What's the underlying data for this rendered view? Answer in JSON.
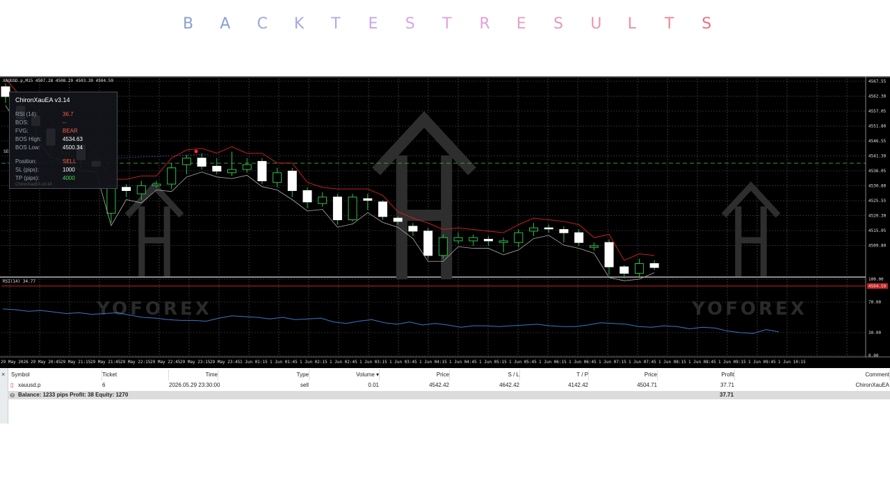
{
  "title_letters": [
    "B",
    "A",
    "C",
    "K",
    "T",
    "E",
    "S",
    "T",
    "R",
    "E",
    "S",
    "U",
    "L",
    "T",
    "S"
  ],
  "title_colors": [
    "#8a9fd8",
    "#8a9fd8",
    "#9ca6e0",
    "#a6a8e4",
    "#b9a8e6",
    "#c8a6e8",
    "#d6a6e6",
    "#dea4e0",
    "#e3a0d4",
    "#e6a0c8",
    "#ea98bc",
    "#ec96b0",
    "#ee8ea6",
    "#ee8698",
    "#ee6e86"
  ],
  "chart": {
    "symbol_line": "XAUUSD.p,M15  4507.28 4508.29 4503.39 4504.59",
    "rsi_label": "RSI(14) 34.77",
    "price_ticks": [
      "4567.55",
      "4562.30",
      "4557.05",
      "4551.80",
      "4546.55",
      "4541.30",
      "4536.05",
      "4530.80",
      "4525.55",
      "4520.30",
      "4515.05",
      "4509.80"
    ],
    "current_price": "4504.59",
    "rsi_ticks": [
      "100.00",
      "70.00",
      "30.00",
      "0.00"
    ],
    "time_ticks": [
      "29 May 2026",
      "29 May 20:45",
      "29 May 21:15",
      "29 May 21:45",
      "29 May 22:15",
      "29 May 22:45",
      "29 May 23:15",
      "29 May 23:45",
      "1 Jun 01:15",
      "1 Jun 01:45",
      "1 Jun 02:15",
      "1 Jun 02:45",
      "1 Jun 03:15",
      "1 Jun 03:45",
      "1 Jun 04:15",
      "1 Jun 04:45",
      "1 Jun 05:15",
      "1 Jun 05:45",
      "1 Jun 06:15",
      "1 Jun 06:45",
      "1 Jun 07:15",
      "1 Jun 07:45",
      "1 Jun 08:15",
      "1 Jun 08:45",
      "1 Jun 09:15",
      "1 Jun 09:45",
      "1 Jun 10:15"
    ],
    "watermark_text": "YOFOREX",
    "sell_marker": "SEL"
  },
  "chart_data": {
    "type": "candlestick",
    "symbol": "XAUUSD.p",
    "timeframe": "M15",
    "ylim": [
      4507.55,
      4568.55
    ],
    "bid_line": 4504.59,
    "entry_line": 4542.42,
    "candles": [
      {
        "o": 4566.0,
        "c": 4563.0,
        "h": 4567.0,
        "l": 4561.0
      },
      {
        "o": 4560.0,
        "c": 4556.0,
        "h": 4561.5,
        "l": 4554.0
      },
      {
        "o": 4557.0,
        "c": 4554.0,
        "h": 4558.0,
        "l": 4551.0
      },
      {
        "o": 4553.0,
        "c": 4548.0,
        "h": 4554.0,
        "l": 4545.0
      },
      {
        "o": 4545.5,
        "c": 4548.5,
        "h": 4549.5,
        "l": 4544.0
      },
      {
        "o": 4548.0,
        "c": 4543.5,
        "h": 4549.0,
        "l": 4541.0
      },
      {
        "o": 4543.0,
        "c": 4541.5,
        "h": 4544.0,
        "l": 4540.5
      },
      {
        "o": 4527.0,
        "c": 4535.5,
        "h": 4536.0,
        "l": 4524.0
      },
      {
        "o": 4535.0,
        "c": 4534.0,
        "h": 4536.0,
        "l": 4532.0
      },
      {
        "o": 4533.0,
        "c": 4535.5,
        "h": 4537.0,
        "l": 4531.0
      },
      {
        "o": 4535.5,
        "c": 4536.0,
        "h": 4537.0,
        "l": 4535.0
      },
      {
        "o": 4536.0,
        "c": 4541.0,
        "h": 4542.5,
        "l": 4534.5
      },
      {
        "o": 4542.0,
        "c": 4544.0,
        "h": 4545.0,
        "l": 4539.0
      },
      {
        "o": 4544.0,
        "c": 4541.5,
        "h": 4545.5,
        "l": 4540.5
      },
      {
        "o": 4541.5,
        "c": 4540.0,
        "h": 4544.0,
        "l": 4539.0
      },
      {
        "o": 4539.5,
        "c": 4540.5,
        "h": 4546.0,
        "l": 4538.5
      },
      {
        "o": 4540.5,
        "c": 4542.0,
        "h": 4544.0,
        "l": 4539.5
      },
      {
        "o": 4543.0,
        "c": 4537.0,
        "h": 4544.0,
        "l": 4536.0
      },
      {
        "o": 4536.5,
        "c": 4539.5,
        "h": 4541.0,
        "l": 4535.0
      },
      {
        "o": 4540.0,
        "c": 4534.0,
        "h": 4541.0,
        "l": 4532.0
      },
      {
        "o": 4534.0,
        "c": 4530.5,
        "h": 4535.0,
        "l": 4528.5
      },
      {
        "o": 4530.0,
        "c": 4532.0,
        "h": 4533.5,
        "l": 4529.0
      },
      {
        "o": 4532.0,
        "c": 4525.0,
        "h": 4533.0,
        "l": 4523.5
      },
      {
        "o": 4525.0,
        "c": 4532.0,
        "h": 4533.0,
        "l": 4524.5
      },
      {
        "o": 4531.5,
        "c": 4531.0,
        "h": 4533.0,
        "l": 4528.0
      },
      {
        "o": 4530.5,
        "c": 4526.0,
        "h": 4531.0,
        "l": 4525.0
      },
      {
        "o": 4525.5,
        "c": 4524.5,
        "h": 4526.0,
        "l": 4523.5
      },
      {
        "o": 4523.0,
        "c": 4521.5,
        "h": 4524.0,
        "l": 4520.0
      },
      {
        "o": 4521.5,
        "c": 4514.0,
        "h": 4522.5,
        "l": 4513.0
      },
      {
        "o": 4514.0,
        "c": 4519.5,
        "h": 4520.5,
        "l": 4513.0
      },
      {
        "o": 4518.5,
        "c": 4519.5,
        "h": 4521.0,
        "l": 4517.5
      },
      {
        "o": 4518.5,
        "c": 4519.5,
        "h": 4520.5,
        "l": 4517.0
      },
      {
        "o": 4519.0,
        "c": 4518.5,
        "h": 4520.0,
        "l": 4517.0
      },
      {
        "o": 4518.0,
        "c": 4518.5,
        "h": 4519.5,
        "l": 4515.0
      },
      {
        "o": 4518.0,
        "c": 4521.0,
        "h": 4522.0,
        "l": 4516.5
      },
      {
        "o": 4521.5,
        "c": 4522.5,
        "h": 4524.0,
        "l": 4520.0
      },
      {
        "o": 4522.5,
        "c": 4522.3,
        "h": 4523.5,
        "l": 4521.0
      },
      {
        "o": 4522.0,
        "c": 4521.0,
        "h": 4523.0,
        "l": 4518.0
      },
      {
        "o": 4521.0,
        "c": 4518.0,
        "h": 4522.0,
        "l": 4517.0
      },
      {
        "o": 4516.5,
        "c": 4517.0,
        "h": 4518.0,
        "l": 4515.5
      },
      {
        "o": 4518.0,
        "c": 4510.5,
        "h": 4519.0,
        "l": 4508.0
      },
      {
        "o": 4510.5,
        "c": 4508.5,
        "h": 4511.0,
        "l": 4507.0
      },
      {
        "o": 4508.5,
        "c": 4511.5,
        "h": 4513.0,
        "l": 4507.5
      },
      {
        "o": 4511.5,
        "c": 4510.3,
        "h": 4512.5,
        "l": 4509.5
      }
    ],
    "rsi": [
      61,
      60,
      58,
      59,
      57,
      55,
      56,
      54,
      55,
      56,
      53,
      50,
      49,
      47,
      46,
      46,
      45,
      49,
      52,
      51,
      50,
      48,
      50,
      47,
      48,
      49,
      44,
      42,
      45,
      47,
      43,
      41,
      44,
      40,
      42,
      40,
      37,
      39,
      39,
      38,
      39,
      40,
      41,
      39,
      38,
      38,
      40,
      43,
      42,
      41,
      38,
      37,
      39,
      38,
      35,
      37,
      36,
      32,
      30,
      29,
      34,
      31
    ]
  },
  "info_panel": {
    "header": "ChironXauEA  v3.14",
    "rows": [
      {
        "label": "RSI (14):",
        "value": "36.7",
        "color": "#ff5a4a"
      },
      {
        "label": "BOS:",
        "value": "--",
        "color": "#ff5a4a"
      },
      {
        "label": "FVG:",
        "value": "BEAR",
        "color": "#ff5a4a"
      },
      {
        "label": "BOS High:",
        "value": "4534.63",
        "color": "#ffffff"
      },
      {
        "label": "BOS Low:",
        "value": "4500.34",
        "color": "#ffffff"
      },
      {
        "label": "Position:",
        "value": "SELL",
        "color": "#ff5a4a"
      },
      {
        "label": "SL (pips):",
        "value": "1000",
        "color": "#ffffff"
      },
      {
        "label": "TP (pips):",
        "value": "4000",
        "color": "#4cdc5a"
      }
    ],
    "footer": "ChironXauEA v3.14"
  },
  "terminal": {
    "close": "×",
    "headers": [
      "Symbol",
      "Ticket",
      "Time",
      "Type",
      "Volume",
      "Price",
      "S / L",
      "T / P",
      "Price",
      "Profit",
      "Comment"
    ],
    "row": [
      "xauusd.p",
      "6",
      "2026.05.29 23:30:00",
      "sell",
      "0.01",
      "4542.42",
      "4642.42",
      "4142.42",
      "4504.71",
      "37.71",
      "ChironXauEA"
    ],
    "balance_label": "Balance: 1233 pips   Profit: 38   Equity: 1270",
    "balance_profit": "37.71"
  }
}
